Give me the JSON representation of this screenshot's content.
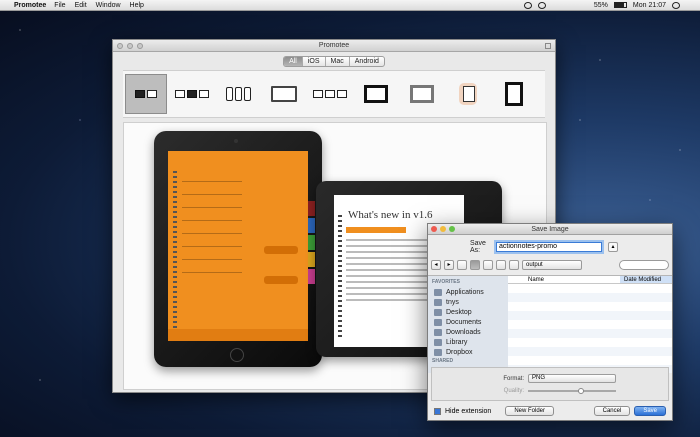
{
  "menubar": {
    "app": "Promotee",
    "items": [
      "File",
      "Edit",
      "Window",
      "Help"
    ],
    "battery": "55%",
    "clock": "Mon 21:07"
  },
  "promotee": {
    "title": "Promotee",
    "segments": [
      "All",
      "iOS",
      "Mac",
      "Android"
    ],
    "selected_segment": "All"
  },
  "ipad_screen": {
    "heading": "What's new in v1.6"
  },
  "dialog": {
    "title": "Save Image",
    "save_as_label": "Save As:",
    "filename": "actionnotes-promo",
    "folder": "output",
    "favorites_header": "FAVORITES",
    "shared_header": "SHARED",
    "favorites": [
      "Applications",
      "tnys",
      "Desktop",
      "Documents",
      "Downloads",
      "Library",
      "Dropbox"
    ],
    "columns": {
      "name": "Name",
      "date": "Date Modified"
    },
    "format_label": "Format:",
    "format_value": "PNG",
    "quality_label": "Quality:",
    "quality_level": 0.6,
    "hide_extension_label": "Hide extension",
    "hide_extension_checked": true,
    "new_folder_label": "New Folder",
    "cancel_label": "Cancel",
    "save_label": "Save"
  },
  "colors": {
    "accent": "#f08f1f",
    "save_blue": "#2a70d6"
  }
}
